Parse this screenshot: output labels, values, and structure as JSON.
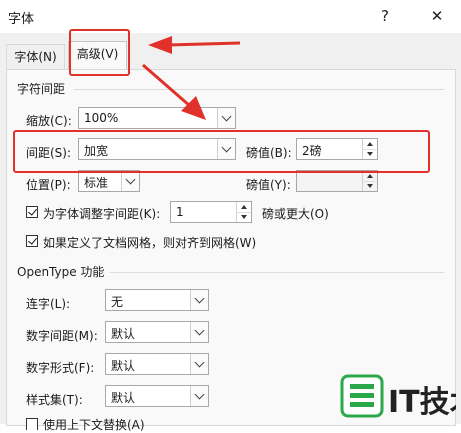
{
  "dialog": {
    "title": "字体",
    "help_symbol": "?",
    "close_symbol": "✕",
    "tabs": [
      {
        "label": "字体(N)",
        "active": false
      },
      {
        "label": "高级(V)",
        "active": true
      }
    ]
  },
  "char_spacing": {
    "section_title": "字符间距",
    "scale": {
      "label": "缩放(C):",
      "value": "100%"
    },
    "spacing": {
      "label": "间距(S):",
      "value": "加宽",
      "by_label": "磅值(B):",
      "by_value": "2磅"
    },
    "position": {
      "label": "位置(P):",
      "value": "标准",
      "by_label": "磅值(Y):",
      "by_value": ""
    },
    "kerning": {
      "label": "为字体调整字间距(K):",
      "value": "1",
      "suffix": "磅或更大(O)",
      "checked": true
    },
    "snap_grid": {
      "label": "如果定义了文档网格，则对齐到网格(W)",
      "checked": true
    }
  },
  "opentype": {
    "section_title": "OpenType 功能",
    "ligatures": {
      "label": "连字(L):",
      "value": "无"
    },
    "number_spacing": {
      "label": "数字间距(M):",
      "value": "默认"
    },
    "number_forms": {
      "label": "数字形式(F):",
      "value": "默认"
    },
    "stylistic_sets": {
      "label": "样式集(T):",
      "value": "默认"
    },
    "contextual": {
      "label": "使用上下文替换(A)",
      "checked": false
    }
  },
  "annotation": {
    "color": "#e0312b"
  },
  "watermark": {
    "text": "IT技术"
  }
}
